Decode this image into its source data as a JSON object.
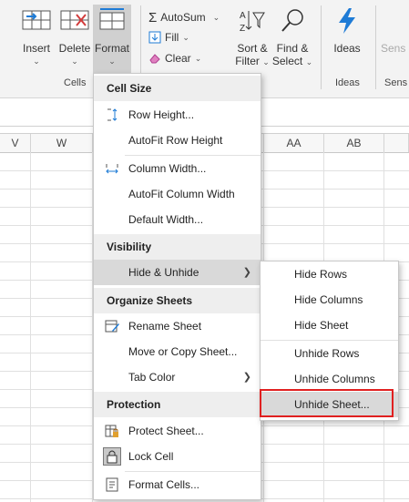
{
  "ribbon": {
    "insert_label": "Insert",
    "delete_label": "Delete",
    "format_label": "Format",
    "autosum_label": "AutoSum",
    "fill_label": "Fill",
    "clear_label": "Clear",
    "sort_filter_line1": "Sort &",
    "sort_filter_line2": "Filter",
    "find_select_line1": "Find &",
    "find_select_line2": "Select",
    "ideas_label": "Ideas",
    "sens_label": "Sens",
    "cells_group": "Cells",
    "ideas_group": "Ideas",
    "sens_group": "Sens"
  },
  "sheet": {
    "columns": [
      "V",
      "W",
      "AA",
      "AB"
    ]
  },
  "format_menu": {
    "cell_size_header": "Cell Size",
    "row_height": "Row Height...",
    "autofit_row_height": "AutoFit Row Height",
    "column_width": "Column Width...",
    "autofit_column_width": "AutoFit Column Width",
    "default_width": "Default Width...",
    "visibility_header": "Visibility",
    "hide_unhide": "Hide & Unhide",
    "organize_header": "Organize Sheets",
    "rename_sheet": "Rename Sheet",
    "move_copy_sheet": "Move or Copy Sheet...",
    "tab_color": "Tab Color",
    "protection_header": "Protection",
    "protect_sheet": "Protect Sheet...",
    "lock_cell": "Lock Cell",
    "format_cells": "Format Cells..."
  },
  "hide_submenu": {
    "hide_rows": "Hide Rows",
    "hide_columns": "Hide Columns",
    "hide_sheet": "Hide Sheet",
    "unhide_rows": "Unhide Rows",
    "unhide_columns": "Unhide Columns",
    "unhide_sheet": "Unhide Sheet..."
  },
  "colors": {
    "highlight_box": "#e02020",
    "ideas_icon": "#1e7bd6",
    "format_active": "#d0d0d0"
  }
}
